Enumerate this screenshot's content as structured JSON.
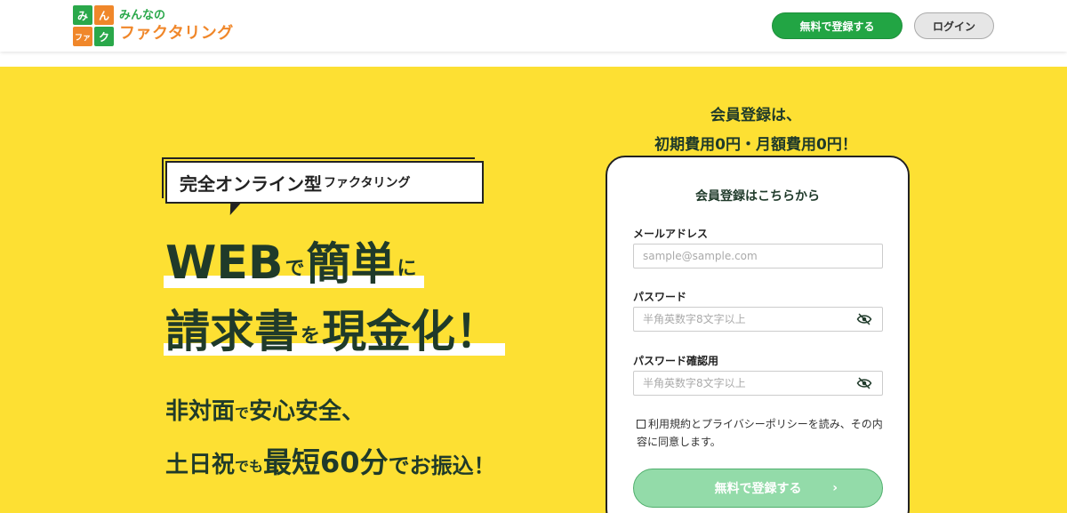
{
  "header": {
    "logo": {
      "mark_chars": [
        "み",
        "ん",
        "ファ",
        "ク"
      ],
      "small_text": "みんなの",
      "big_text": "ファクタリング"
    },
    "register_label": "無料で登録する",
    "login_label": "ログイン"
  },
  "hero": {
    "tag": {
      "main": "完全オンライン型",
      "sub": "ファクタリング"
    },
    "headline1": {
      "a": "WEB",
      "b": "で",
      "c": "簡単",
      "d": "に"
    },
    "headline2": {
      "a": "請求書",
      "b": "を",
      "c": "現金化！"
    },
    "subline1": {
      "a": "非対面",
      "b": "で",
      "c": "安心安全、"
    },
    "subline2": {
      "a": "土日祝",
      "b": "でも",
      "c": "最短60分",
      "d": "でお振込！"
    }
  },
  "promo": {
    "line1": "会員登録は、",
    "line2": "初期費用0円・月額費用0円！"
  },
  "form": {
    "title": "会員登録はこちらから",
    "email_label": "メールアドレス",
    "email_placeholder": "sample@sample.com",
    "password_label": "パスワード",
    "password_placeholder": "半角英数字8文字以上",
    "password_confirm_label": "パスワード確認用",
    "password_confirm_placeholder": "半角英数字8文字以上",
    "agree_text": "利用規約とプライバシーポリシーを読み、その内容に同意します。",
    "submit_label": "無料で登録する",
    "submit_chevron": "›"
  },
  "colors": {
    "brand_green": "#22a544",
    "brand_orange": "#f0872a",
    "hero_yellow": "#fde033",
    "text_dark": "#1f3a2a"
  }
}
